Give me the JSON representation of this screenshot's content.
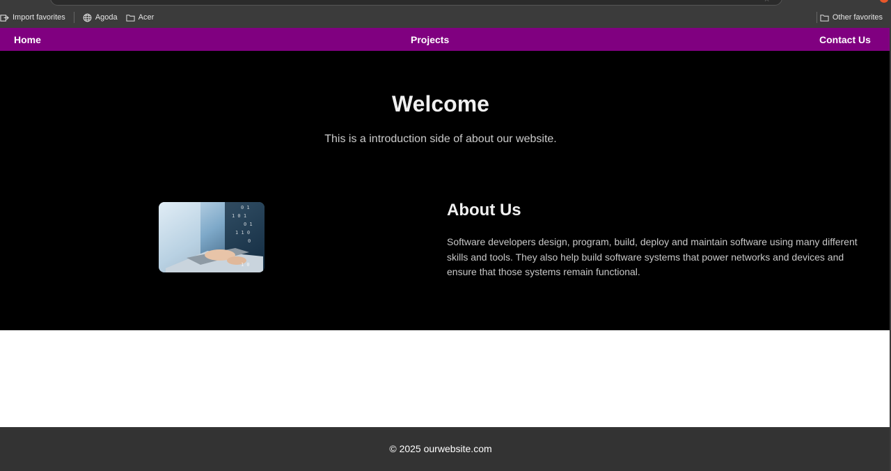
{
  "browser": {
    "bookmarks": [
      {
        "label": "Import favorites",
        "icon": "import-icon"
      },
      {
        "label": "Agoda",
        "icon": "globe-icon"
      },
      {
        "label": "Acer",
        "icon": "folder-icon"
      }
    ],
    "other_favorites": "Other favorites"
  },
  "nav": {
    "home": "Home",
    "projects": "Projects",
    "contact": "Contact Us",
    "color": "#800080"
  },
  "hero": {
    "title": "Welcome",
    "subtitle": "This is a introduction side of about our website."
  },
  "about": {
    "title": "About Us",
    "text": "Software developers design, program, build, deploy and maintain software using many different skills and tools. They also help build software systems that power networks and devices and ensure that those systems remain functional.",
    "image": "laptop-code-image"
  },
  "footer": {
    "text": "© 2025 ourwebsite.com"
  }
}
